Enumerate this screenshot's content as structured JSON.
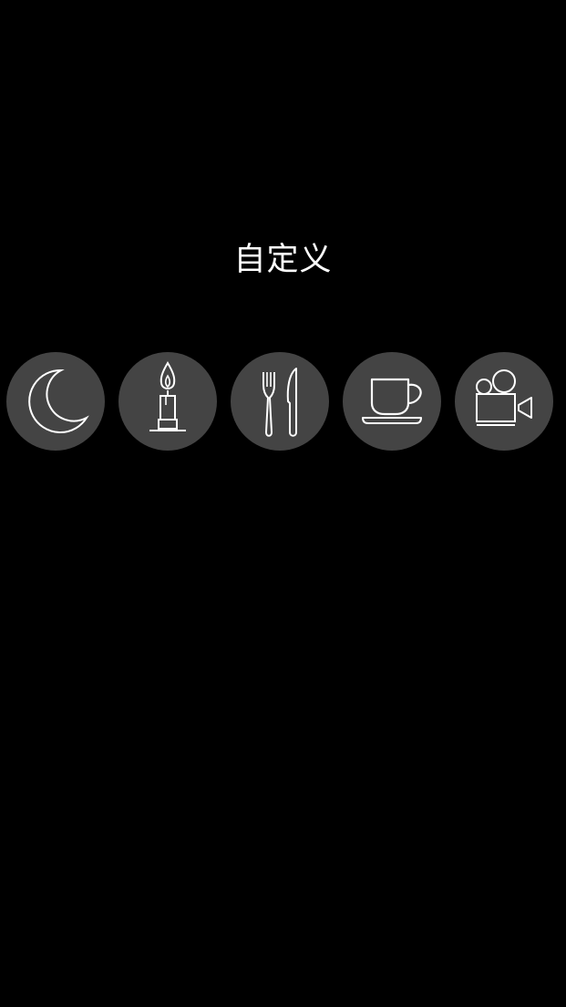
{
  "title": "自定义",
  "scenes": [
    {
      "icon": "moon-icon"
    },
    {
      "icon": "candle-icon"
    },
    {
      "icon": "fork-knife-icon"
    },
    {
      "icon": "coffee-cup-icon"
    },
    {
      "icon": "movie-camera-icon"
    }
  ],
  "colors": {
    "background": "#000000",
    "button": "#444444",
    "icon_stroke": "#ffffff",
    "text": "#ffffff"
  }
}
